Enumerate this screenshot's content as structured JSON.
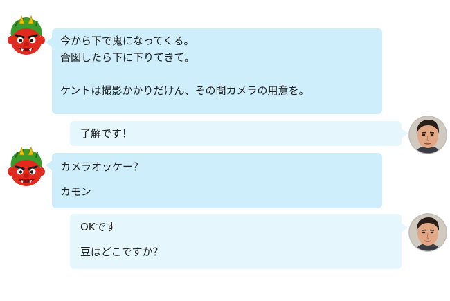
{
  "conversation": {
    "messages": [
      {
        "sender": "oni",
        "avatar_icon": "red-oni-demon-icon",
        "lines": [
          "今から下で鬼になってくる。",
          "合図したら下に下りてきて。",
          "",
          "ケントは撮影かかりだけん、その間カメラの用意を。"
        ]
      },
      {
        "sender": "kento",
        "avatar_icon": "man-face-photo-icon",
        "lines": [
          "了解です！"
        ]
      },
      {
        "sender": "oni",
        "avatar_icon": "red-oni-demon-icon",
        "lines": [
          "カメラオッケー？",
          "カモン"
        ]
      },
      {
        "sender": "kento",
        "avatar_icon": "man-face-photo-icon",
        "lines": [
          "OKです",
          "豆はどこですか？"
        ]
      }
    ]
  },
  "colors": {
    "left_bubble": "#cfeefb",
    "right_bubble": "#e5f6fd",
    "oni_red": "#e02a1e",
    "oni_green": "#3a9a2a",
    "oni_yellow": "#f2c300"
  }
}
